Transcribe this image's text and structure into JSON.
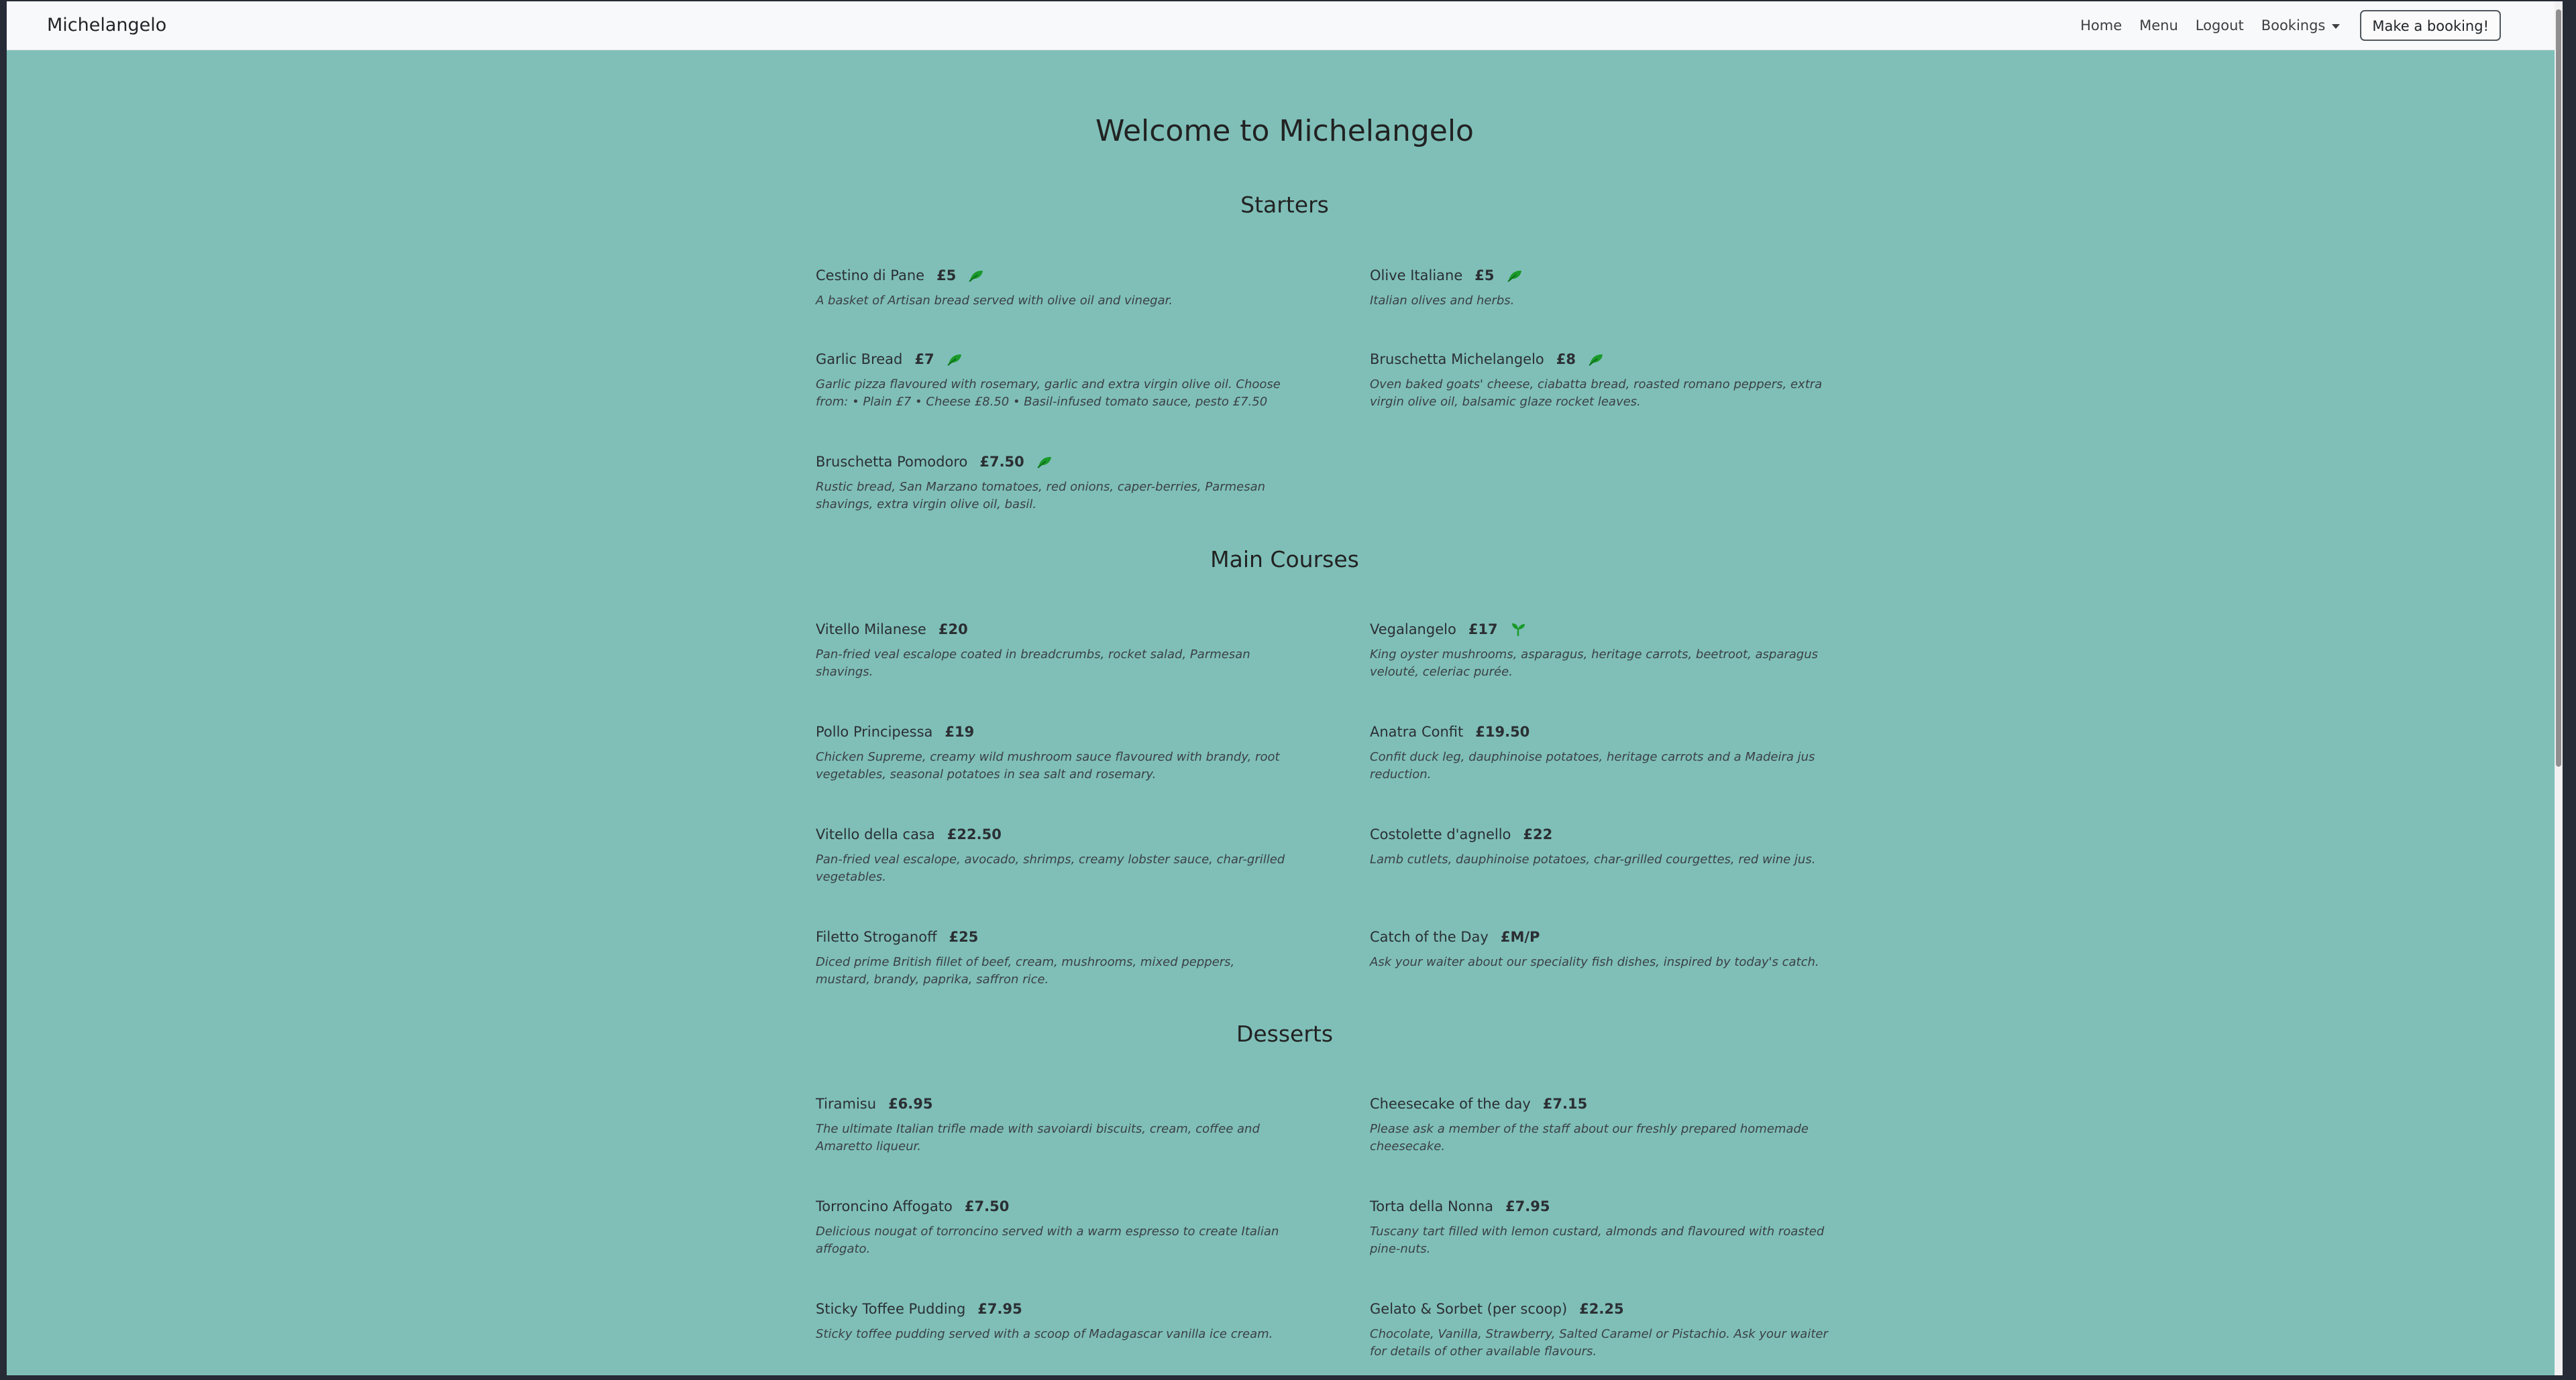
{
  "nav": {
    "brand": "Michelangelo",
    "links": [
      "Home",
      "Menu",
      "Logout"
    ],
    "bookings": "Bookings",
    "book_button": "Make a booking!"
  },
  "page": {
    "welcome": "Welcome to Michelangelo"
  },
  "colors": {
    "background": "#7fbfb8",
    "navbar": "#f8f9fa",
    "leaf_green": "#1a9a2a"
  },
  "menu": {
    "starters_title": "Starters",
    "starters": [
      {
        "name": "Cestino di Pane",
        "price": "£5",
        "icon": "leaf-icon",
        "desc": "A basket of Artisan bread served with olive oil and vinegar."
      },
      {
        "name": "Olive Italiane",
        "price": "£5",
        "icon": "leaf-icon",
        "desc": "Italian olives and herbs."
      },
      {
        "name": "Garlic Bread",
        "price": "£7",
        "icon": "leaf-icon",
        "desc": "Garlic pizza flavoured with rosemary, garlic and extra virgin olive oil. Choose from: • Plain £7 • Cheese £8.50 • Basil-infused tomato sauce, pesto £7.50"
      },
      {
        "name": "Bruschetta Michelangelo",
        "price": "£8",
        "icon": "leaf-icon",
        "desc": "Oven baked goats' cheese, ciabatta bread, roasted romano peppers, extra virgin olive oil, balsamic glaze rocket leaves."
      },
      {
        "name": "Bruschetta Pomodoro",
        "price": "£7.50",
        "icon": "leaf-icon",
        "desc": "Rustic bread, San Marzano tomatoes, red onions, caper-berries, Parmesan shavings, extra virgin olive oil, basil."
      }
    ],
    "mains_title": "Main Courses",
    "mains": [
      {
        "name": "Vitello Milanese",
        "price": "£20",
        "desc": "Pan-fried veal escalope coated in breadcrumbs, rocket salad, Parmesan shavings."
      },
      {
        "name": "Vegalangelo",
        "price": "£17",
        "icon": "seedling-icon",
        "desc": "King oyster mushrooms, asparagus, heritage carrots, beetroot, asparagus velouté, celeriac purée."
      },
      {
        "name": "Pollo Principessa",
        "price": "£19",
        "desc": "Chicken Supreme, creamy wild mushroom sauce flavoured with brandy, root vegetables, seasonal potatoes in sea salt and rosemary."
      },
      {
        "name": "Anatra Confit",
        "price": "£19.50",
        "desc": "Confit duck leg, dauphinoise potatoes, heritage carrots and a Madeira jus reduction."
      },
      {
        "name": "Vitello della casa",
        "price": "£22.50",
        "desc": "Pan-fried veal escalope, avocado, shrimps, creamy lobster sauce, char-grilled vegetables."
      },
      {
        "name": "Costolette d'agnello",
        "price": "£22",
        "desc": "Lamb cutlets, dauphinoise potatoes, char-grilled courgettes, red wine jus."
      },
      {
        "name": "Filetto Stroganoff",
        "price": "£25",
        "desc": "Diced prime British fillet of beef, cream, mushrooms, mixed peppers, mustard, brandy, paprika, saffron rice."
      },
      {
        "name": "Catch of the Day",
        "price": "£M/P",
        "desc": "Ask your waiter about our speciality fish dishes, inspired by today's catch."
      }
    ],
    "desserts_title": "Desserts",
    "desserts": [
      {
        "name": "Tiramisu",
        "price": "£6.95",
        "desc": "The ultimate Italian trifle made with savoiardi biscuits, cream, coffee and Amaretto liqueur."
      },
      {
        "name": "Cheesecake of the day",
        "price": "£7.15",
        "desc": "Please ask a member of the staff about our freshly prepared homemade cheesecake."
      },
      {
        "name": "Torroncino Affogato",
        "price": "£7.50",
        "desc": "Delicious nougat of torroncino served with a warm espresso to create Italian affogato."
      },
      {
        "name": "Torta della Nonna",
        "price": "£7.95",
        "desc": "Tuscany tart filled with lemon custard, almonds and flavoured with roasted pine-nuts."
      },
      {
        "name": "Sticky Toffee Pudding",
        "price": "£7.95",
        "desc": "Sticky toffee pudding served with a scoop of Madagascar vanilla ice cream."
      },
      {
        "name": "Gelato & Sorbet (per scoop)",
        "price": "£2.25",
        "desc": "Chocolate, Vanilla, Strawberry, Salted Caramel or Pistachio. Ask your waiter for details of other available flavours."
      }
    ]
  }
}
